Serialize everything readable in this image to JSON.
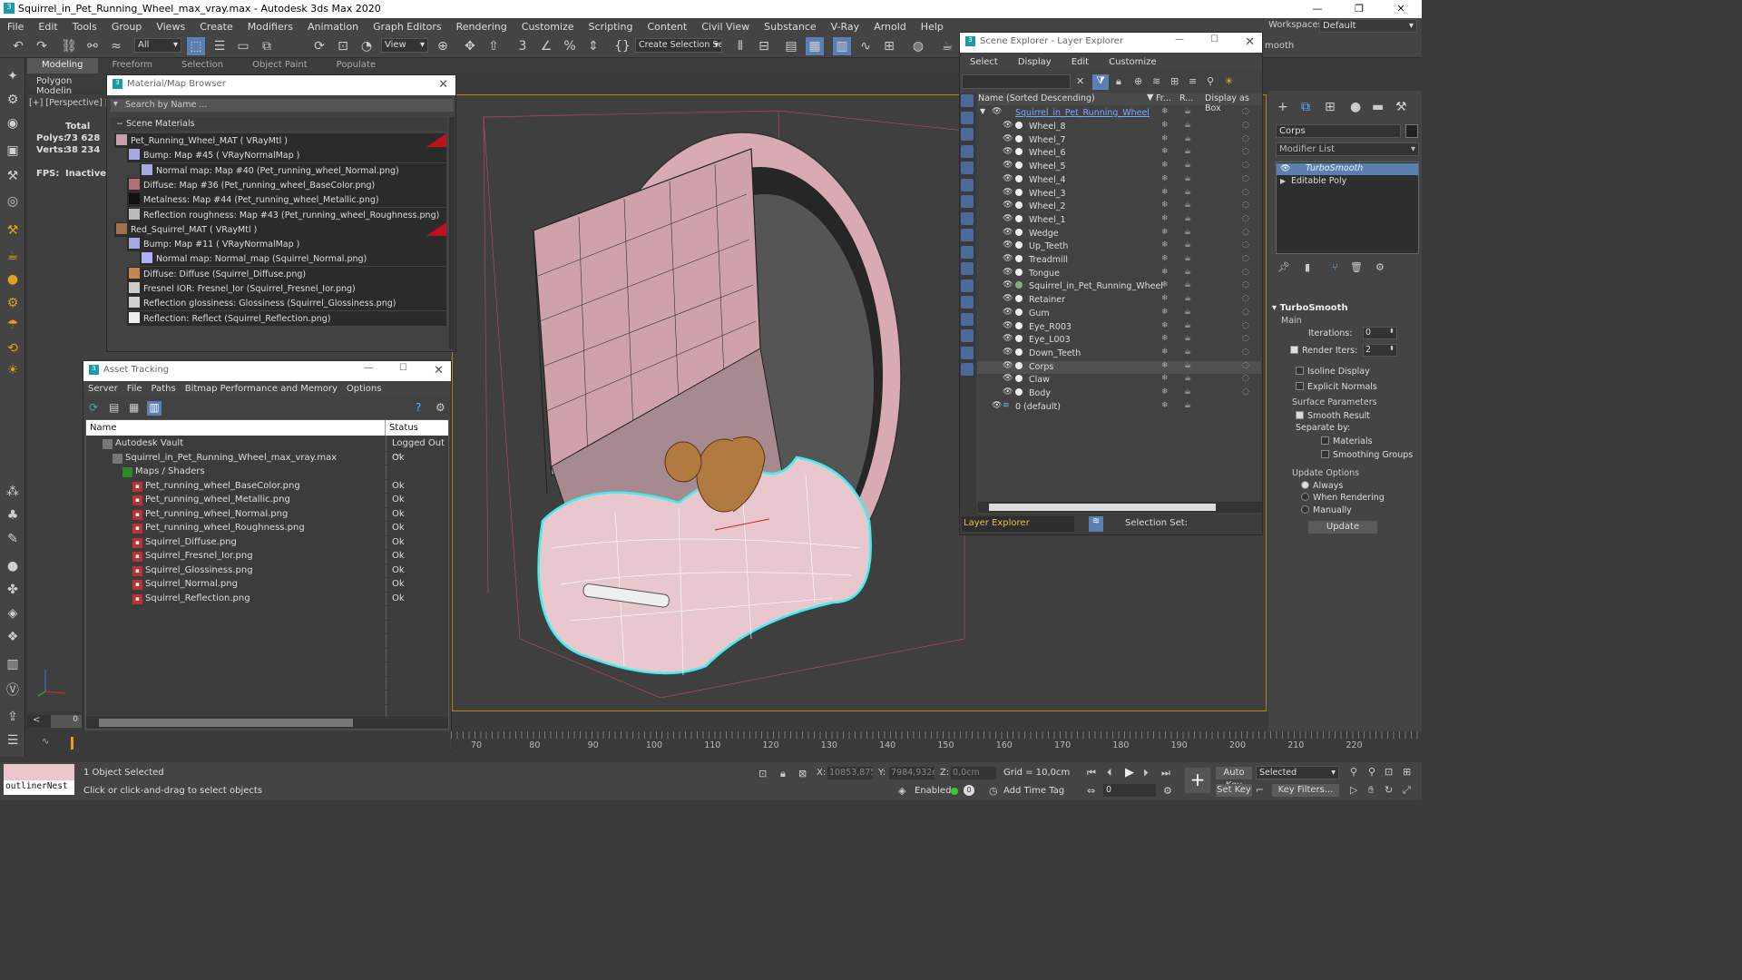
{
  "window": {
    "title": "Squirrel_in_Pet_Running_Wheel_max_vray.max - Autodesk 3ds Max 2020",
    "controls": [
      "—",
      "❒",
      "✕"
    ]
  },
  "menu": [
    "File",
    "Edit",
    "Tools",
    "Group",
    "Views",
    "Create",
    "Modifiers",
    "Animation",
    "Graph Editors",
    "Rendering",
    "Customize",
    "Scripting",
    "Content",
    "Civil View",
    "Substance",
    "V-Ray",
    "Arnold",
    "Help"
  ],
  "workspace": {
    "label": "Workspaces:",
    "value": "Default"
  },
  "toolbar": {
    "filter": "All",
    "view": "View",
    "selection_set": "Create Selection Se"
  },
  "ribbon": {
    "tabs": [
      "Modeling",
      "Freeform",
      "Selection",
      "Object Paint",
      "Populate"
    ],
    "sub": "Polygon Modelin"
  },
  "viewport": {
    "label": "[+] [Perspective] [S",
    "stats": {
      "total_label": "Total",
      "polys_label": "Polys:",
      "polys": "73 628",
      "verts_label": "Verts:",
      "verts": "38 234",
      "fps_label": "FPS:",
      "fps": "Inactive"
    }
  },
  "material_browser": {
    "title": "Material/Map Browser",
    "search_placeholder": "Search by Name ...",
    "section": "Scene Materials",
    "items": [
      {
        "text": "Pet_Running_Wheel_MAT  ( VRayMtl )",
        "indent": 0,
        "swatch": "#c8a0a8",
        "red": true
      },
      {
        "text": "Bump: Map #45  ( VRayNormalMap )",
        "indent": 1,
        "swatch": "#a8a8e0"
      },
      {
        "text": "Normal map: Map #40 (Pet_running_wheel_Normal.png)",
        "indent": 2,
        "swatch": "#a8a8e0"
      },
      {
        "text": "Diffuse: Map #36 (Pet_running_wheel_BaseColor.png)",
        "indent": 1,
        "swatch": "#b07078"
      },
      {
        "text": "Metalness: Map #44 (Pet_running_wheel_Metallic.png)",
        "indent": 1,
        "swatch": "#111111"
      },
      {
        "text": "Reflection roughness: Map #43 (Pet_running_wheel_Roughness.png)",
        "indent": 1,
        "swatch": "#bbbbbb"
      },
      {
        "text": "Red_Squirrel_MAT  ( VRayMtl )",
        "indent": 0,
        "swatch": "#a07050",
        "red": true
      },
      {
        "text": "Bump: Map #11  ( VRayNormalMap )",
        "indent": 1,
        "swatch": "#a8a8e0"
      },
      {
        "text": "Normal map: Normal_map (Squirrel_Normal.png)",
        "indent": 2,
        "swatch": "#b0b0f0"
      },
      {
        "text": "Diffuse: Diffuse (Squirrel_Diffuse.png)",
        "indent": 1,
        "swatch": "#c08850"
      },
      {
        "text": "Fresnel IOR: Fresnel_Ior (Squirrel_Fresnel_Ior.png)",
        "indent": 1,
        "swatch": "#cccccc"
      },
      {
        "text": "Reflection glossiness: Glossiness (Squirrel_Glossiness.png)",
        "indent": 1,
        "swatch": "#d0d0d0"
      },
      {
        "text": "Reflection: Reflect (Squirrel_Reflection.png)",
        "indent": 1,
        "swatch": "#eeeeee"
      }
    ]
  },
  "asset_tracking": {
    "title": "Asset Tracking",
    "menu": [
      "Server",
      "File",
      "Paths",
      "Bitmap Performance and Memory",
      "Options"
    ],
    "col_name": "Name",
    "col_status": "Status",
    "rows": [
      {
        "name": "Autodesk Vault",
        "status": "Logged Out ...",
        "indent": 1
      },
      {
        "name": "Squirrel_in_Pet_Running_Wheel_max_vray.max",
        "status": "Ok",
        "indent": 2
      },
      {
        "name": "Maps / Shaders",
        "status": "",
        "indent": 3
      },
      {
        "name": "Pet_running_wheel_BaseColor.png",
        "status": "Ok",
        "indent": 4
      },
      {
        "name": "Pet_running_wheel_Metallic.png",
        "status": "Ok",
        "indent": 4
      },
      {
        "name": "Pet_running_wheel_Normal.png",
        "status": "Ok",
        "indent": 4
      },
      {
        "name": "Pet_running_wheel_Roughness.png",
        "status": "Ok",
        "indent": 4
      },
      {
        "name": "Squirrel_Diffuse.png",
        "status": "Ok",
        "indent": 4
      },
      {
        "name": "Squirrel_Fresnel_Ior.png",
        "status": "Ok",
        "indent": 4
      },
      {
        "name": "Squirrel_Glossiness.png",
        "status": "Ok",
        "indent": 4
      },
      {
        "name": "Squirrel_Normal.png",
        "status": "Ok",
        "indent": 4
      },
      {
        "name": "Squirrel_Reflection.png",
        "status": "Ok",
        "indent": 4
      }
    ]
  },
  "scene_explorer": {
    "title": "Scene Explorer - Layer Explorer",
    "menu": [
      "Select",
      "Display",
      "Edit",
      "Customize"
    ],
    "col_name": "Name (Sorted Descending)",
    "col_fr": "Fr...",
    "col_r": "R...",
    "col_box": "Display as Box",
    "root": "Squirrel_in_Pet_Running_Wheel",
    "items": [
      "Wheel_8",
      "Wheel_7",
      "Wheel_6",
      "Wheel_5",
      "Wheel_4",
      "Wheel_3",
      "Wheel_2",
      "Wheel_1",
      "Wedge",
      "Up_Teeth",
      "Treadmill",
      "Tongue",
      "Squirrel_in_Pet_Running_Wheel",
      "Retainer",
      "Gum",
      "Eye_R003",
      "Eye_L003",
      "Down_Teeth",
      "Corps",
      "Claw",
      "Body"
    ],
    "selected": "Corps",
    "default_layer": "0 (default)",
    "footer_mode": "Layer Explorer",
    "footer_selset": "Selection Set:"
  },
  "right_panel": {
    "object_name": "Corps",
    "modifier_list": "Modifier List",
    "stack": [
      "TurboSmooth",
      "Editable Poly"
    ],
    "turbosmooth": {
      "title": "TurboSmooth",
      "main": "Main",
      "iterations_label": "Iterations:",
      "iterations": "0",
      "render_iters_label": "Render Iters:",
      "render_iters": "2",
      "isoline": "Isoline Display",
      "explicit": "Explicit Normals",
      "surface": "Surface Parameters",
      "smooth": "Smooth Result",
      "separate": "Separate by:",
      "materials": "Materials",
      "smoothing": "Smoothing Groups",
      "update_opts": "Update Options",
      "always": "Always",
      "when_rendering": "When Rendering",
      "manually": "Manually",
      "update": "Update"
    },
    "truncated": "mooth"
  },
  "timeline": {
    "ticks": [
      "70",
      "80",
      "90",
      "100",
      "110",
      "120",
      "130",
      "140",
      "150",
      "160",
      "170",
      "180",
      "190",
      "200",
      "210",
      "220"
    ],
    "slider_left": "<",
    "slider_pos": "0"
  },
  "status": {
    "script_field": "outlinerNest",
    "selected": "1 Object Selected",
    "hint": "Click or click-and-drag to select objects",
    "x_label": "X:",
    "x": "10853,875",
    "y_label": "Y:",
    "y": "7984,932c",
    "z_label": "Z:",
    "z": "0,0cm",
    "grid": "Grid = 10,0cm",
    "enabled": "Enabled:",
    "add_time_tag": "Add Time Tag",
    "auto_key": "Auto Key",
    "set_key": "Set Key",
    "selected_dd": "Selected",
    "key_filters": "Key Filters...",
    "frame": "0"
  }
}
